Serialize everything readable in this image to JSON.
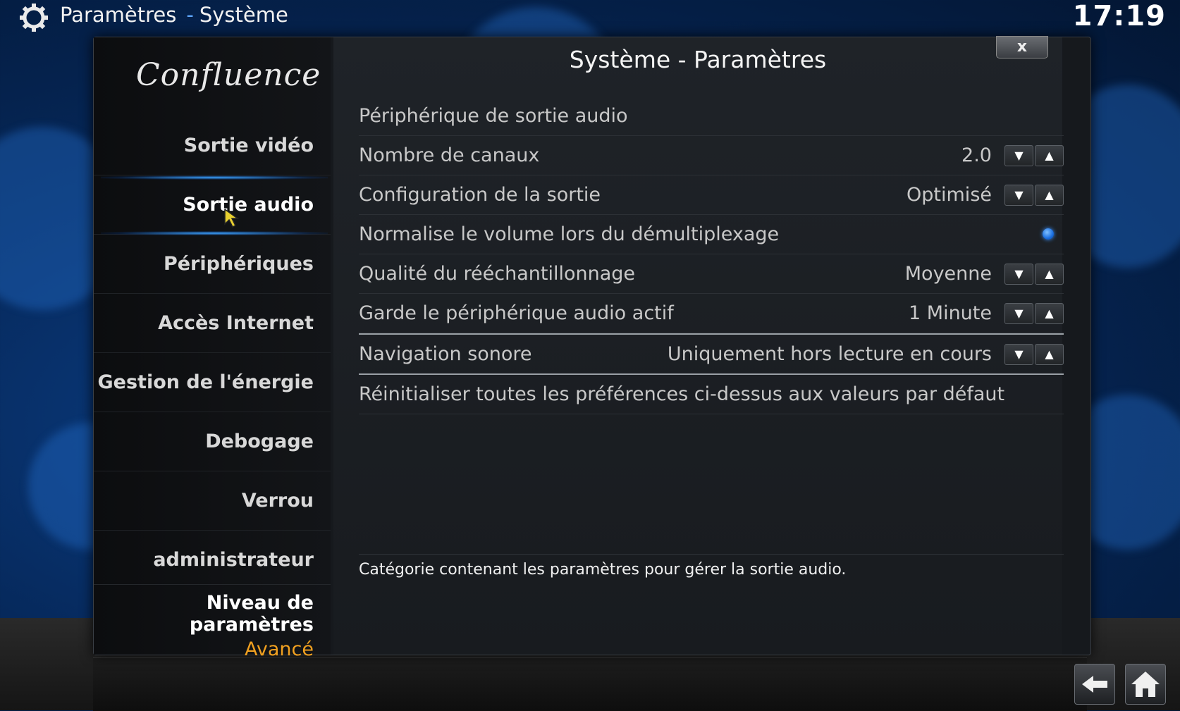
{
  "header": {
    "section": "Paramètres",
    "subsection": "Système",
    "clock": "17:19"
  },
  "dialog": {
    "title": "Système - Paramètres",
    "close_label": "x",
    "logo": "Confluence"
  },
  "sidebar": {
    "items": [
      {
        "label": "Sortie vidéo"
      },
      {
        "label": "Sortie audio"
      },
      {
        "label": "Périphériques"
      },
      {
        "label": "Accès Internet"
      },
      {
        "label": "Gestion de l'énergie"
      },
      {
        "label": "Debogage"
      },
      {
        "label": "Verrou administrateur"
      }
    ],
    "active_index": 1,
    "level_label": "Niveau de paramètres",
    "level_value": "Avancé"
  },
  "settings": [
    {
      "label": "Périphérique de sortie audio",
      "value": "",
      "control": "none"
    },
    {
      "label": "Nombre de canaux",
      "value": "2.0",
      "control": "spinner"
    },
    {
      "label": "Configuration de la sortie",
      "value": "Optimisé",
      "control": "spinner"
    },
    {
      "label": "Normalise le volume lors du démultiplexage",
      "value": "",
      "control": "radio",
      "checked": true
    },
    {
      "label": "Qualité du rééchantillonnage",
      "value": "Moyenne",
      "control": "spinner"
    },
    {
      "label": "Garde le périphérique audio actif",
      "value": "1 Minute",
      "control": "spinner"
    },
    {
      "label": "Navigation sonore",
      "value": "Uniquement hors lecture en cours",
      "control": "spinner",
      "focused": true
    },
    {
      "label": "Réinitialiser toutes les préférences ci-dessus aux valeurs par défaut",
      "value": "",
      "control": "none"
    }
  ],
  "description": "Catégorie contenant les paramètres pour gérer la sortie audio.",
  "colors": {
    "accent": "#f0a020",
    "highlight": "#3aa0ff",
    "background": "#06285a"
  },
  "icons": {
    "header": "gear-icon",
    "back": "back-arrow-icon",
    "home": "home-icon"
  }
}
